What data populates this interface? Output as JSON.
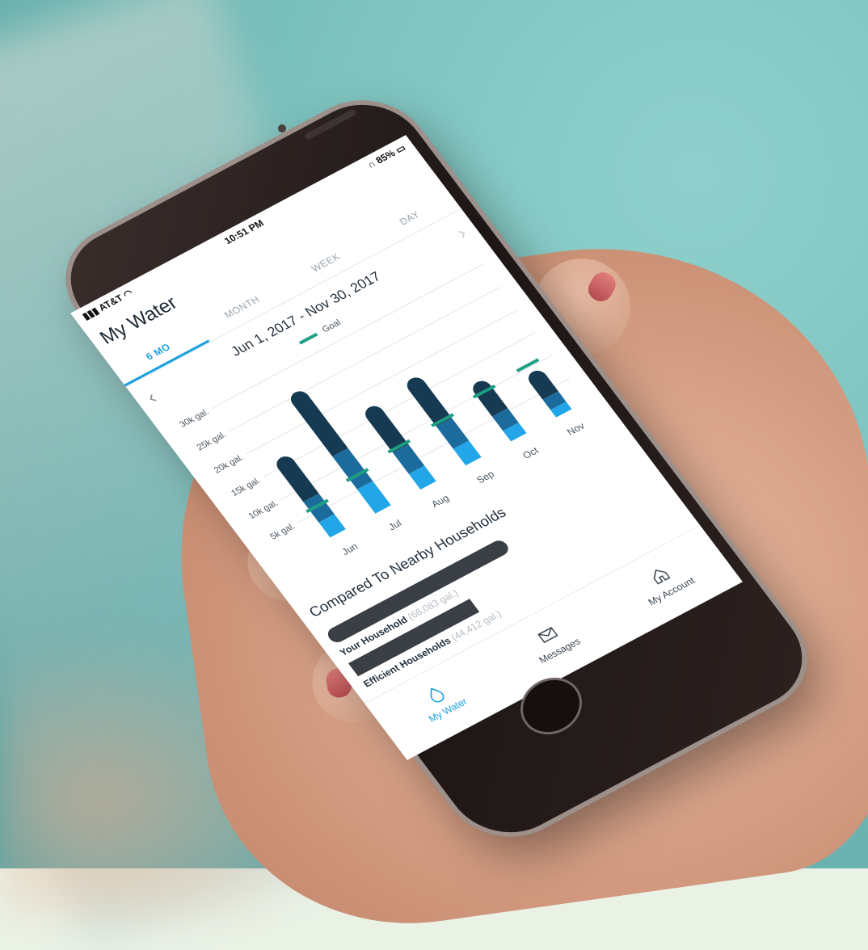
{
  "status_bar": {
    "carrier": "AT&T",
    "time": "10:51 PM",
    "battery": "85%"
  },
  "app": {
    "title": "My Water"
  },
  "tabs": [
    {
      "label": "6 MO",
      "active": true
    },
    {
      "label": "MONTH",
      "active": false
    },
    {
      "label": "WEEK",
      "active": false
    },
    {
      "label": "DAY",
      "active": false
    }
  ],
  "range_label": "Jun 1, 2017 - Nov 30, 2017",
  "legend": {
    "goal": "Goal"
  },
  "chart_data": {
    "type": "bar",
    "categories": [
      "Jun",
      "Jul",
      "Aug",
      "Sep",
      "Oct",
      "Nov"
    ],
    "values": [
      15000,
      24000,
      15500,
      16500,
      10500,
      7500
    ],
    "goal": [
      6000,
      7500,
      8500,
      9000,
      10000,
      10500
    ],
    "y_ticks": [
      "5k gal.",
      "10k gal.",
      "15k gal.",
      "20k gal.",
      "25k gal.",
      "30k gal."
    ],
    "ylim": [
      0,
      30000
    ],
    "colors": {
      "bar_dark": "#163a52",
      "bar_mid": "#1b6c9c",
      "bar_light": "#23a6e8",
      "goal": "#1e9e82"
    }
  },
  "comparison": {
    "title": "Compared To Nearby Households",
    "rows": [
      {
        "label": "Your Household",
        "value": "(66,083 gal.)",
        "fill": 0.62
      },
      {
        "label": "Efficient Households",
        "value": "(44,412 gal.)",
        "fill": 0.42
      }
    ]
  },
  "bottom_nav": [
    {
      "label": "My Water",
      "icon": "water-drop-icon",
      "active": true
    },
    {
      "label": "Messages",
      "icon": "envelope-icon",
      "active": false
    },
    {
      "label": "My Account",
      "icon": "home-icon",
      "active": false
    }
  ]
}
